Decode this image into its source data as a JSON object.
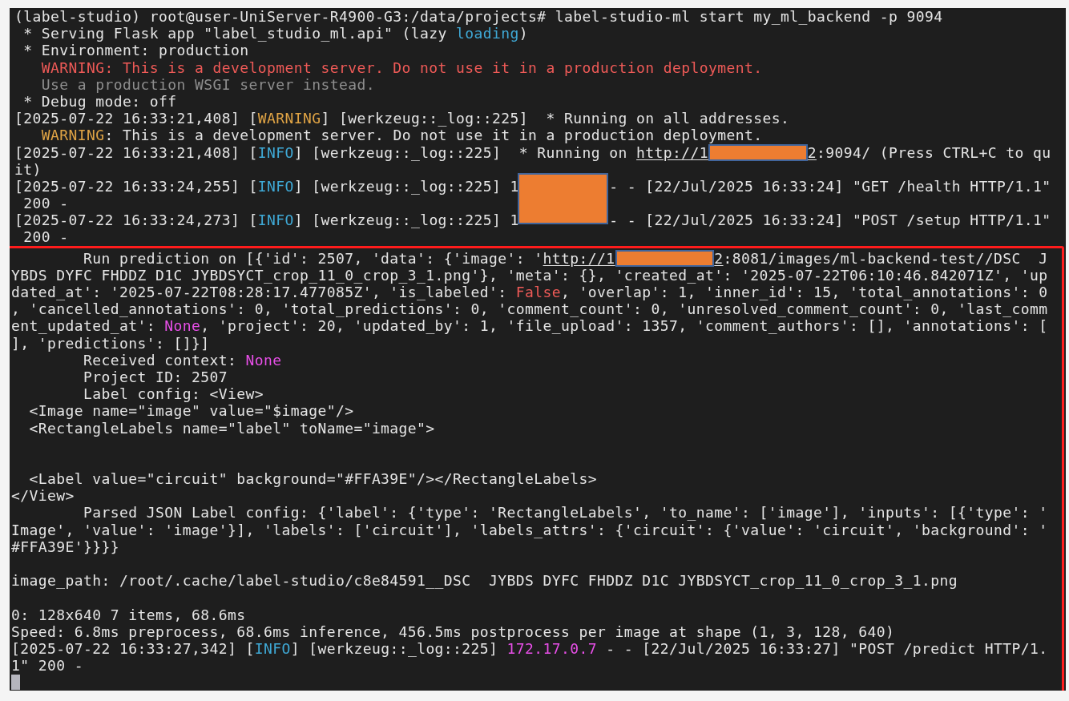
{
  "terminal": {
    "blocks": [
      {
        "kind": "plain",
        "lines": [
          {
            "segments": [
              {
                "text": "(label-studio) root@user-UniServer-R4900-G3:/data/projects# label-studio-ml start my_ml_backend -p 9094"
              }
            ]
          },
          {
            "segments": [
              {
                "text": " * Serving Flask app \"label_studio_ml.api\" (lazy "
              },
              {
                "text": "loading",
                "color": "#3fa9d6"
              },
              {
                "text": ")"
              }
            ]
          },
          {
            "segments": [
              {
                "text": " * Environment: production"
              }
            ]
          },
          {
            "segments": [
              {
                "text": "   WARNING: This is a development server. Do not use it in a production deployment.",
                "color": "#ee5a57"
              }
            ]
          },
          {
            "segments": [
              {
                "text": "   Use a production WSGI server instead.",
                "color": "#8e8e8e"
              }
            ]
          },
          {
            "segments": [
              {
                "text": " * Debug mode: off"
              }
            ]
          },
          {
            "segments": [
              {
                "text": "[2025-07-22 16:33:21,408] ["
              },
              {
                "text": "WARNING",
                "color": "#e0a445"
              },
              {
                "text": "] [werkzeug::_log::225]  * Running on all addresses."
              }
            ]
          },
          {
            "segments": [
              {
                "text": "   WARNING",
                "color": "#e0a445"
              },
              {
                "text": ": This is a development server. Do not use it in a production deployment."
              }
            ]
          },
          {
            "segments": [
              {
                "text": "[2025-07-22 16:33:21,408] ["
              },
              {
                "text": "INFO",
                "color": "#3fa9d6"
              },
              {
                "text": "] [werkzeug::_log::225]  * Running on "
              },
              {
                "text": "http://1",
                "underline": true
              },
              {
                "kind": "redaction"
              },
              {
                "text": "2",
                "underline": true
              },
              {
                "text": ":9094/ (Press CTRL+C to qu"
              }
            ]
          },
          {
            "segments": [
              {
                "text": "it)"
              }
            ]
          },
          {
            "segments": [
              {
                "text": "[2025-07-22 16:33:24,255] ["
              },
              {
                "text": "INFO",
                "color": "#3fa9d6"
              },
              {
                "text": "] [werkzeug::_log::225] 1"
              },
              {
                "kind": "redaction-tall"
              },
              {
                "text": "- - [22/Jul/2025 16:33:24] \"GET /health HTTP/1.1\""
              }
            ]
          },
          {
            "segments": [
              {
                "text": " 200 -"
              }
            ]
          },
          {
            "segments": [
              {
                "text": "[2025-07-22 16:33:24,273] ["
              },
              {
                "text": "INFO",
                "color": "#3fa9d6"
              },
              {
                "text": "] [werkzeug::_log::225] 1"
              },
              {
                "kind": "covered"
              },
              {
                "text": "- - [22/Jul/2025 16:33:24] \"POST /setup HTTP/1.1\""
              }
            ]
          },
          {
            "segments": [
              {
                "text": " 200 -"
              }
            ]
          }
        ]
      },
      {
        "kind": "highlighted",
        "lines": [
          {
            "segments": [
              {
                "text": "        Run prediction on [{'id': 2507, 'data': {'image': '"
              },
              {
                "text": "http://1",
                "underline": true
              },
              {
                "kind": "redaction"
              },
              {
                "text": "2",
                "underline": true
              },
              {
                "text": ":8081/images/ml-backend-test//DSC  J"
              }
            ]
          },
          {
            "segments": [
              {
                "text": "YBDS DYFC FHDDZ D1C JYBDSYCT_crop_11_0_crop_3_1.png'}, 'meta': {}, 'created_at': '2025-07-22T06:10:46.842071Z', 'up"
              }
            ]
          },
          {
            "segments": [
              {
                "text": "dated_at': '2025-07-22T08:28:17.477085Z', 'is_labeled': "
              },
              {
                "text": "False",
                "color": "#ee5a57"
              },
              {
                "text": ", 'overlap': 1, 'inner_id': 15, 'total_annotations': 0"
              }
            ]
          },
          {
            "segments": [
              {
                "text": ", 'cancelled_annotations': 0, 'total_predictions': 0, 'comment_count': 0, 'unresolved_comment_count': 0, 'last_comm"
              }
            ]
          },
          {
            "segments": [
              {
                "text": "ent_updated_at': "
              },
              {
                "text": "None",
                "color": "#e84fe8"
              },
              {
                "text": ", 'project': 20, 'updated_by': 1, 'file_upload': 1357, 'comment_authors': [], 'annotations': ["
              }
            ]
          },
          {
            "segments": [
              {
                "text": "], 'predictions': []}]"
              }
            ]
          },
          {
            "segments": [
              {
                "text": "        Received context: "
              },
              {
                "text": "None",
                "color": "#e84fe8"
              }
            ]
          },
          {
            "segments": [
              {
                "text": "        Project ID: 2507"
              }
            ]
          },
          {
            "segments": [
              {
                "text": "        Label config: <View>"
              }
            ]
          },
          {
            "segments": [
              {
                "text": "  <Image name=\"image\" value=\"$image\"/>"
              }
            ]
          },
          {
            "segments": [
              {
                "text": "  <RectangleLabels name=\"label\" toName=\"image\">"
              }
            ]
          },
          {
            "kind": "blank"
          },
          {
            "kind": "blank"
          },
          {
            "segments": [
              {
                "text": "  <Label value=\"circuit\" background=\"#FFA39E\"/></RectangleLabels>"
              }
            ]
          },
          {
            "segments": [
              {
                "text": "</View>"
              }
            ]
          },
          {
            "segments": [
              {
                "text": "        Parsed JSON Label config: {'label': {'type': 'RectangleLabels', 'to_name': ['image'], 'inputs': [{'type': '"
              }
            ]
          },
          {
            "segments": [
              {
                "text": "Image', 'value': 'image'}], 'labels': ['circuit'], 'labels_attrs': {'circuit': {'value': 'circuit', 'background': '"
              }
            ]
          },
          {
            "segments": [
              {
                "text": "#FFA39E'}}}}"
              }
            ]
          },
          {
            "kind": "blank"
          },
          {
            "segments": [
              {
                "text": "image_path: /root/.cache/label-studio/c8e84591__DSC  JYBDS DYFC FHDDZ D1C JYBDSYCT_crop_11_0_crop_3_1.png"
              }
            ]
          },
          {
            "kind": "blank"
          },
          {
            "segments": [
              {
                "text": "0: 128x640 7 items, 68.6ms"
              }
            ]
          },
          {
            "segments": [
              {
                "text": "Speed: 6.8ms preprocess, 68.6ms inference, 456.5ms postprocess per image at shape (1, 3, 128, 640)"
              }
            ]
          },
          {
            "segments": [
              {
                "text": "[2025-07-22 16:33:27,342] ["
              },
              {
                "text": "INFO",
                "color": "#3fa9d6"
              },
              {
                "text": "] [werkzeug::_log::225] "
              },
              {
                "text": "172.17.0.7",
                "color": "#e84fe8"
              },
              {
                "text": " - - [22/Jul/2025 16:33:27] \"POST /predict HTTP/1."
              }
            ]
          },
          {
            "segments": [
              {
                "text": "1\" 200 -"
              }
            ]
          },
          {
            "kind": "cursor"
          }
        ]
      }
    ]
  }
}
